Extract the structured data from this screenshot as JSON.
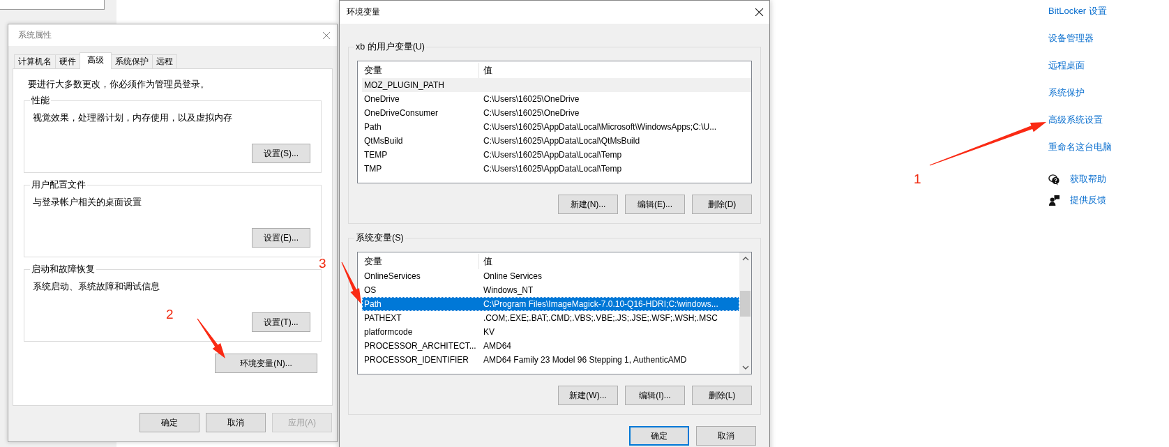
{
  "system_properties": {
    "title": "系统属性",
    "tabs": [
      {
        "label": "计算机名",
        "selected": false
      },
      {
        "label": "硬件",
        "selected": false
      },
      {
        "label": "高级",
        "selected": true
      },
      {
        "label": "系统保护",
        "selected": false
      },
      {
        "label": "远程",
        "selected": false
      }
    ],
    "notice": "要进行大多数更改，你必须作为管理员登录。",
    "groups": [
      {
        "title": "性能",
        "description": "视觉效果，处理器计划，内存使用，以及虚拟内存",
        "button": "设置(S)..."
      },
      {
        "title": "用户配置文件",
        "description": "与登录帐户相关的桌面设置",
        "button": "设置(E)..."
      },
      {
        "title": "启动和故障恢复",
        "description": "系统启动、系统故障和调试信息",
        "button": "设置(T)..."
      }
    ],
    "env_button": "环境变量(N)...",
    "buttons": [
      {
        "label": "确定",
        "disabled": false
      },
      {
        "label": "取消",
        "disabled": false
      },
      {
        "label": "应用(A)",
        "disabled": true
      }
    ]
  },
  "environment_variables": {
    "title": "环境变量",
    "lists": [
      {
        "title": "xb 的用户变量(U)",
        "focused": false,
        "scrollbar": false,
        "columns": [
          "变量",
          "值"
        ],
        "rows": [
          {
            "variable": "MOZ_PLUGIN_PATH",
            "selected": true
          },
          {
            "variable": "OneDrive",
            "value": "C:\\Users\\16025\\OneDrive",
            "selected": false
          },
          {
            "variable": "OneDriveConsumer",
            "value": "C:\\Users\\16025\\OneDrive",
            "selected": false
          },
          {
            "variable": "Path",
            "value": "C:\\Users\\16025\\AppData\\Local\\Microsoft\\WindowsApps;C:\\U...",
            "selected": false
          },
          {
            "variable": "QtMsBuild",
            "value": "C:\\Users\\16025\\AppData\\Local\\QtMsBuild",
            "selected": false
          },
          {
            "variable": "TEMP",
            "value": "C:\\Users\\16025\\AppData\\Local\\Temp",
            "selected": false
          },
          {
            "variable": "TMP",
            "value": "C:\\Users\\16025\\AppData\\Local\\Temp",
            "selected": false
          }
        ],
        "buttons": [
          "新建(N)...",
          "编辑(E)...",
          "删除(D)"
        ]
      },
      {
        "title": "系统变量(S)",
        "focused": true,
        "scrollbar": true,
        "columns": [
          "变量",
          "值"
        ],
        "rows": [
          {
            "variable": "OnlineServices",
            "value": "Online Services",
            "selected": false
          },
          {
            "variable": "OS",
            "value": "Windows_NT",
            "selected": false
          },
          {
            "variable": "Path",
            "value": "C:\\Program Files\\ImageMagick-7.0.10-Q16-HDRI;C:\\windows...",
            "selected": true
          },
          {
            "variable": "PATHEXT",
            "value": ".COM;.EXE;.BAT;.CMD;.VBS;.VBE;.JS;.JSE;.WSF;.WSH;.MSC",
            "selected": false
          },
          {
            "variable": "platformcode",
            "value": "KV",
            "selected": false
          },
          {
            "variable": "PROCESSOR_ARCHITECT...",
            "value": "AMD64",
            "selected": false
          },
          {
            "variable": "PROCESSOR_IDENTIFIER",
            "value": "AMD64 Family 23 Model 96 Stepping 1, AuthenticAMD",
            "selected": false
          }
        ],
        "buttons": [
          "新建(W)...",
          "编辑(I)...",
          "删除(L)"
        ]
      }
    ],
    "buttons": [
      {
        "label": "确定",
        "default": true
      },
      {
        "label": "取消",
        "default": false
      }
    ]
  },
  "related_links": [
    "BitLocker 设置",
    "设备管理器",
    "远程桌面",
    "系统保护",
    "高级系统设置",
    "重命名这台电脑"
  ],
  "help_links": [
    {
      "label": "获取帮助",
      "kind": "help"
    },
    {
      "label": "提供反馈",
      "kind": "feedback"
    }
  ],
  "annotations": [
    {
      "label": "1"
    },
    {
      "label": "2"
    },
    {
      "label": "3"
    }
  ]
}
